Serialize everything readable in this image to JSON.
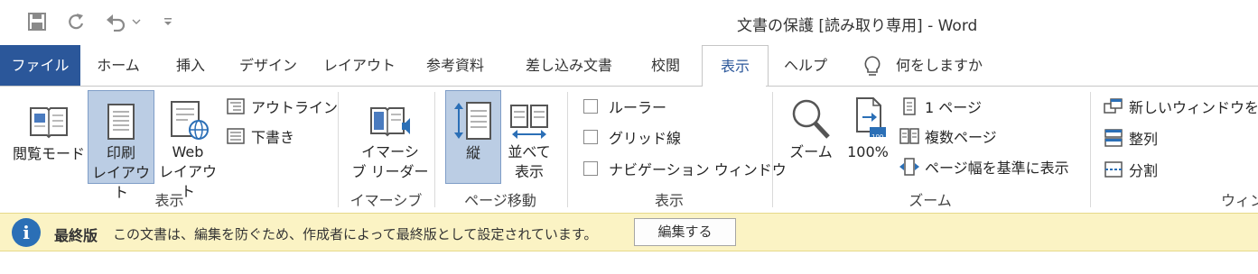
{
  "window": {
    "title": "文書の保護 [読み取り専用]  -  Word"
  },
  "qat": {
    "items": [
      "save-icon",
      "redo-icon",
      "undo-icon",
      "chevron-down-icon",
      "customize-qat-icon"
    ]
  },
  "tabs": [
    {
      "label": "ファイル"
    },
    {
      "label": "ホーム"
    },
    {
      "label": "挿入"
    },
    {
      "label": "デザイン"
    },
    {
      "label": "レイアウト"
    },
    {
      "label": "参考資料"
    },
    {
      "label": "差し込み文書"
    },
    {
      "label": "校閲"
    },
    {
      "label": "表示"
    },
    {
      "label": "ヘルプ"
    }
  ],
  "tell_me": {
    "label": "何をしますか"
  },
  "ribbon": {
    "views": {
      "group_label": "表示",
      "read_mode": "閲覧モード",
      "print_layout": "印刷\nレイアウト",
      "web_layout": "Web\nレイアウト",
      "outline": "アウトライン",
      "draft": "下書き"
    },
    "immersive": {
      "group_label": "イマーシブ",
      "reader": "イマーシ\nブ リーダー"
    },
    "page_movement": {
      "group_label": "ページ移動",
      "vertical": "縦",
      "side_by_side": "並べて\n表示"
    },
    "show": {
      "group_label": "表示",
      "ruler": "ルーラー",
      "gridlines": "グリッド線",
      "nav_pane": "ナビゲーション ウィンドウ"
    },
    "zoom": {
      "group_label": "ズーム",
      "zoom": "ズーム",
      "hundred": "100%",
      "hundred_badge": "100",
      "one_page": "1 ページ",
      "multiple_pages": "複数ページ",
      "page_width": "ページ幅を基準に表示"
    },
    "window": {
      "group_label": "ウィン",
      "new_window": "新しいウィンドウを開く",
      "arrange_all": "整列",
      "split": "分割"
    }
  },
  "message_bar": {
    "title": "最終版",
    "text": "この文書は、編集を防ぐため、作成者によって最終版として設定されています。",
    "button": "編集する"
  },
  "colors": {
    "accent": "#2b579a",
    "selected_bg": "#bbcde4",
    "message_bg": "#fbf3c4"
  }
}
